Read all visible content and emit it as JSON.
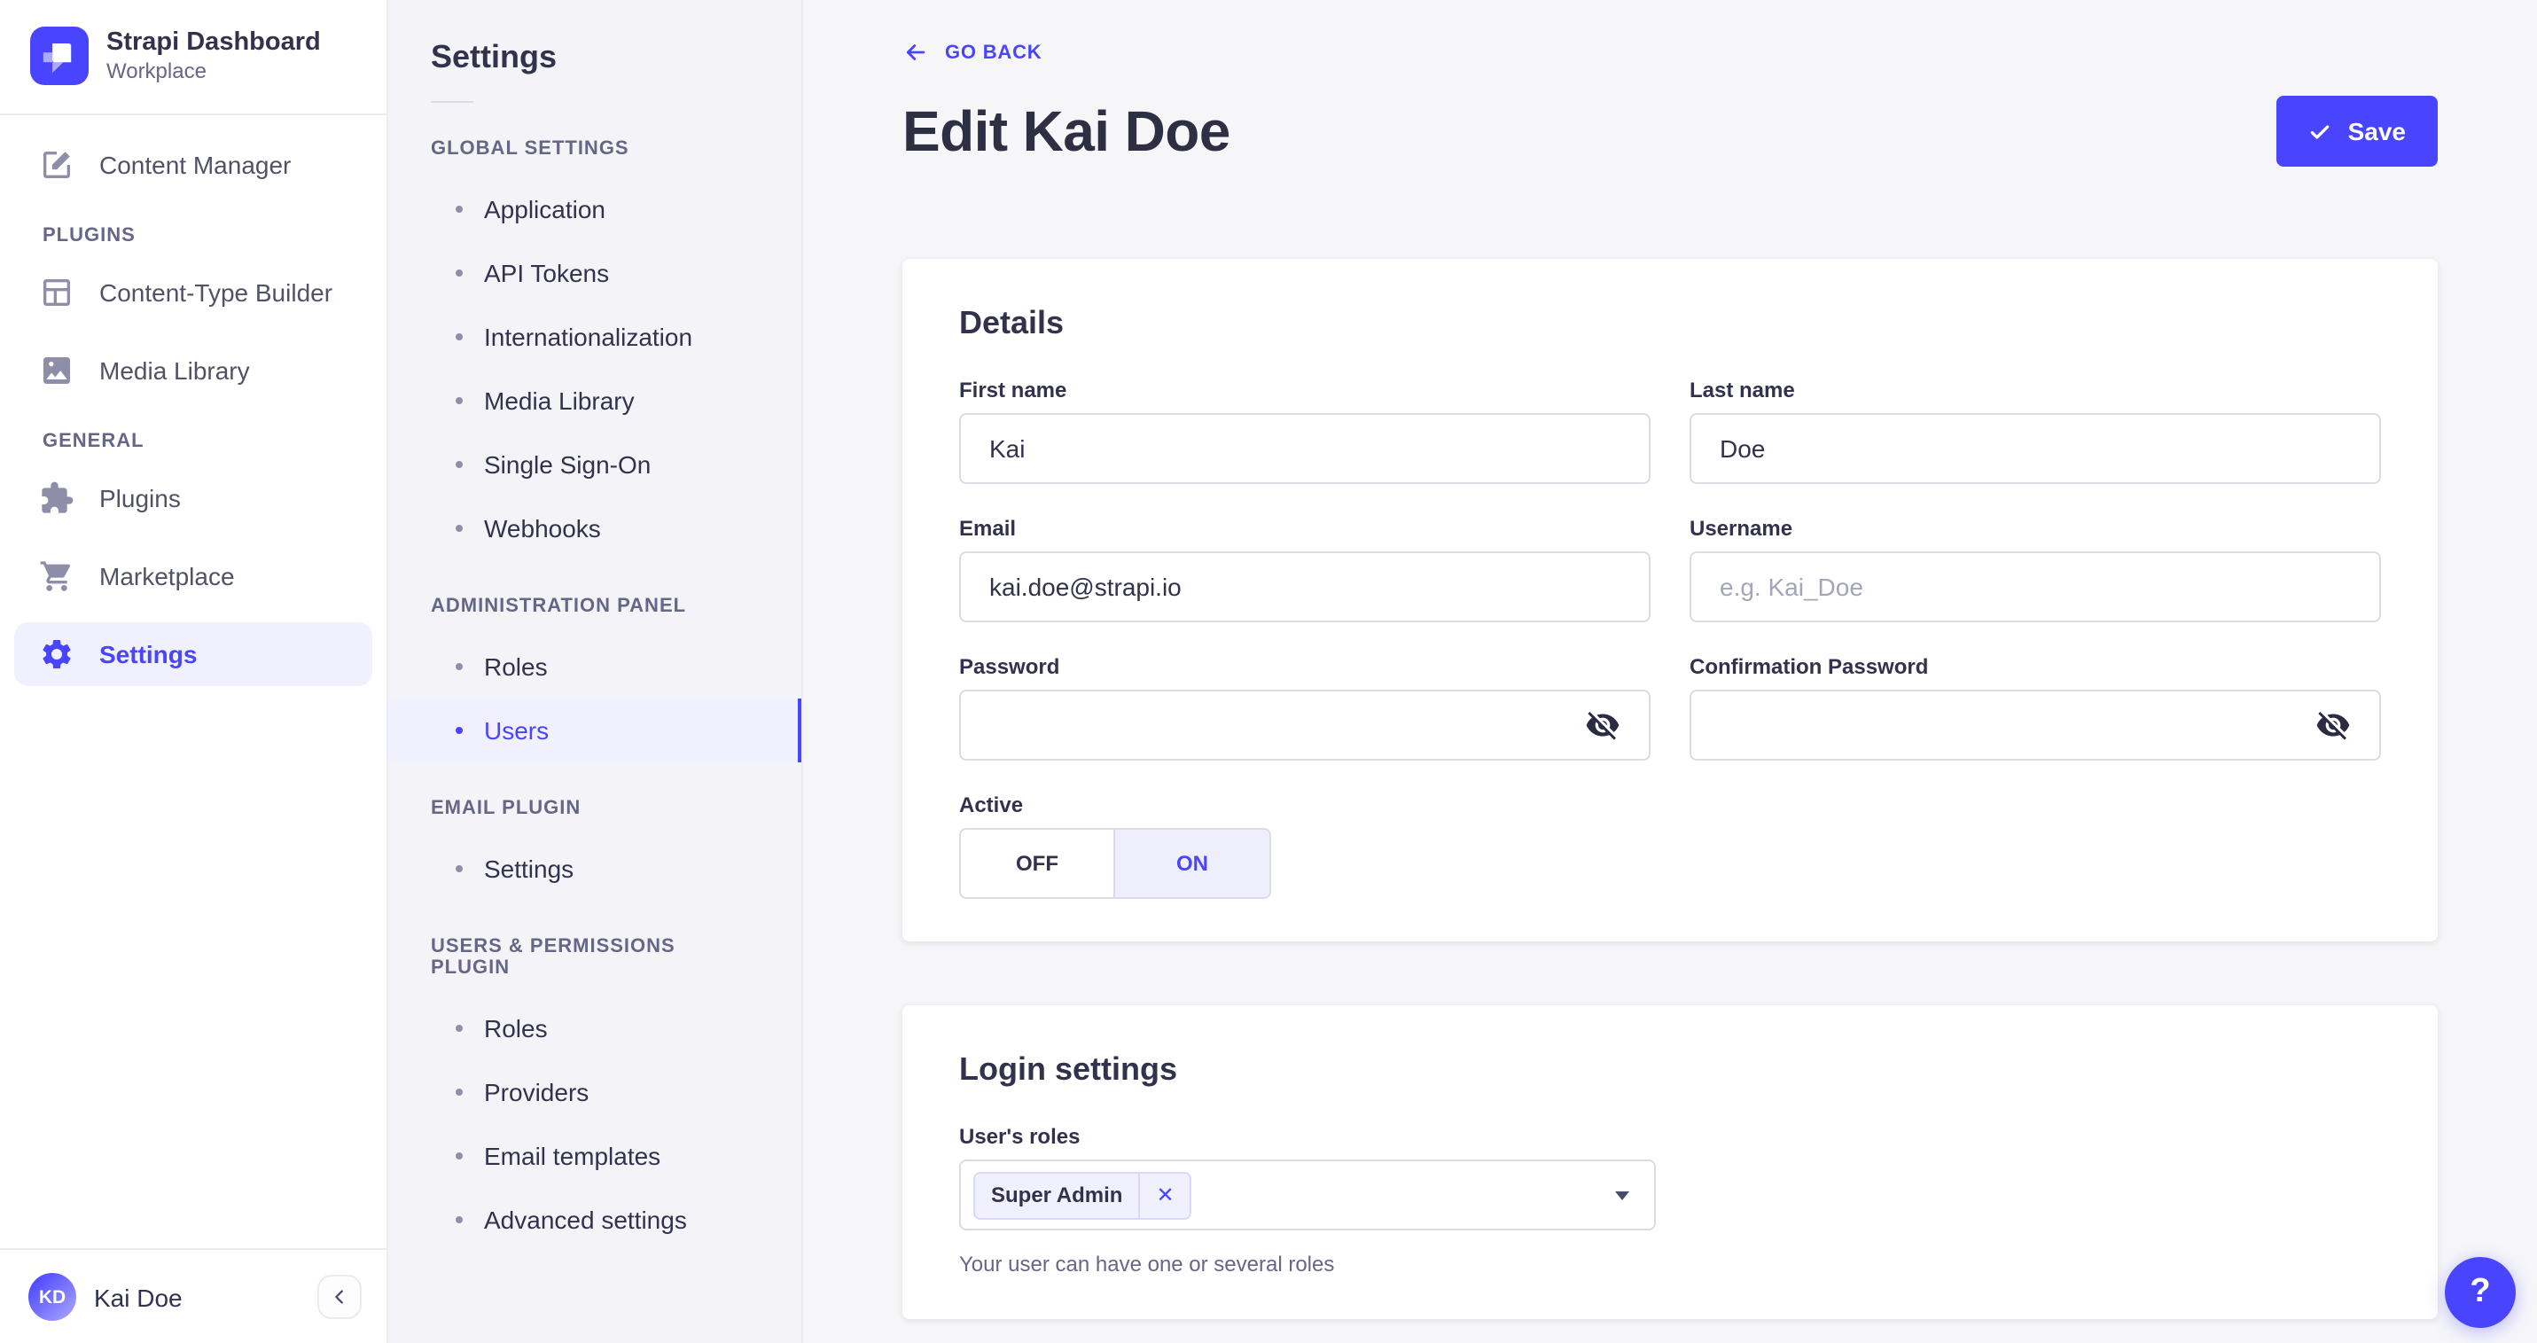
{
  "colors": {
    "accent": "#4945ff",
    "accent_light": "#f0f0ff",
    "text_dark": "#32324d",
    "text_gray": "#666687"
  },
  "brand": {
    "name": "Strapi Dashboard",
    "workspace": "Workplace"
  },
  "sidebar": {
    "top_item": {
      "label": "Content Manager"
    },
    "sections": [
      {
        "title": "PLUGINS",
        "items": [
          {
            "label": "Content-Type Builder"
          },
          {
            "label": "Media Library"
          }
        ]
      },
      {
        "title": "GENERAL",
        "items": [
          {
            "label": "Plugins"
          },
          {
            "label": "Marketplace"
          },
          {
            "label": "Settings"
          }
        ]
      }
    ],
    "user": {
      "initials": "KD",
      "name": "Kai Doe"
    }
  },
  "subnav": {
    "title": "Settings",
    "sections": [
      {
        "title": "GLOBAL SETTINGS",
        "items": [
          "Application",
          "API Tokens",
          "Internationalization",
          "Media Library",
          "Single Sign-On",
          "Webhooks"
        ]
      },
      {
        "title": "ADMINISTRATION PANEL",
        "items": [
          "Roles",
          "Users"
        ]
      },
      {
        "title": "EMAIL PLUGIN",
        "items": [
          "Settings"
        ]
      },
      {
        "title": "USERS & PERMISSIONS PLUGIN",
        "items": [
          "Roles",
          "Providers",
          "Email templates",
          "Advanced settings"
        ]
      }
    ],
    "active_item": "Users"
  },
  "main": {
    "back_label": "GO BACK",
    "title": "Edit Kai Doe",
    "save_label": "Save",
    "details": {
      "heading": "Details",
      "fields": {
        "first_name": {
          "label": "First name",
          "value": "Kai"
        },
        "last_name": {
          "label": "Last name",
          "value": "Doe"
        },
        "email": {
          "label": "Email",
          "value": "kai.doe@strapi.io"
        },
        "username": {
          "label": "Username",
          "value": "",
          "placeholder": "e.g. Kai_Doe"
        },
        "password": {
          "label": "Password",
          "value": ""
        },
        "confirmation_password": {
          "label": "Confirmation Password",
          "value": ""
        },
        "active": {
          "label": "Active",
          "off_label": "OFF",
          "on_label": "ON",
          "value": "ON"
        }
      }
    },
    "login": {
      "heading": "Login settings",
      "roles_label": "User's roles",
      "selected_roles": [
        "Super Admin"
      ],
      "remove_label": "✕",
      "helper": "Your user can have one or several roles"
    },
    "help_label": "?"
  }
}
